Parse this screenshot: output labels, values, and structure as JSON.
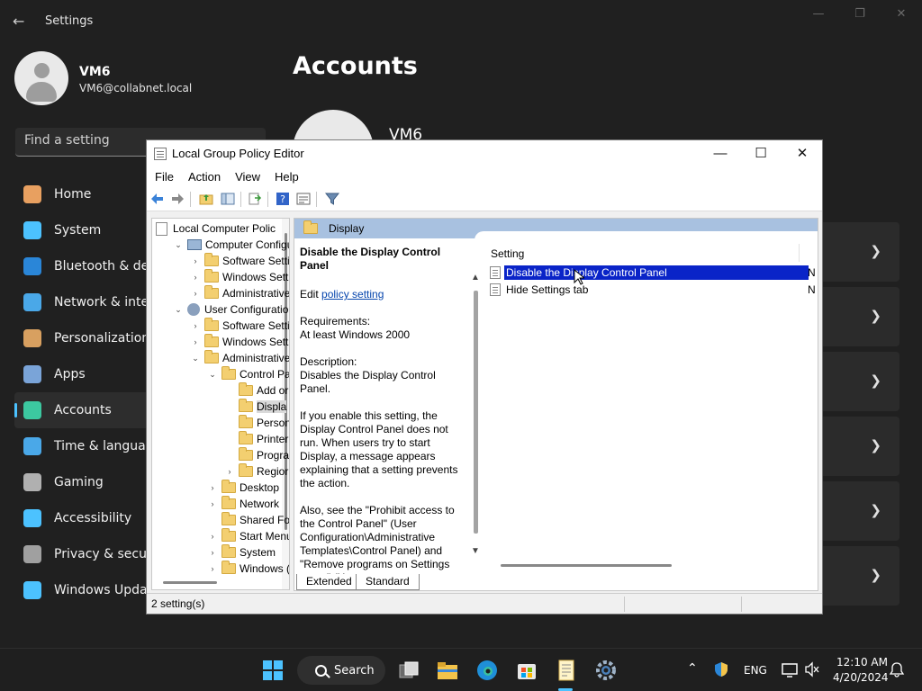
{
  "settings": {
    "app_title": "Settings",
    "profile": {
      "name": "VM6",
      "email": "VM6@collabnet.local"
    },
    "search_placeholder": "Find a setting",
    "page_heading": "Accounts",
    "account_name": "VM6",
    "nav_items": [
      {
        "label": "Home",
        "icon": "home-icon",
        "color": "#e8a060"
      },
      {
        "label": "System",
        "icon": "system-icon",
        "color": "#4cc2ff"
      },
      {
        "label": "Bluetooth & devices",
        "icon": "bluetooth-icon",
        "color": "#2a86d8"
      },
      {
        "label": "Network & internet",
        "icon": "wifi-icon",
        "color": "#4aa8e8"
      },
      {
        "label": "Personalization",
        "icon": "brush-icon",
        "color": "#d8a060"
      },
      {
        "label": "Apps",
        "icon": "apps-icon",
        "color": "#7aa4d8"
      },
      {
        "label": "Accounts",
        "icon": "person-icon",
        "color": "#3cc8a0"
      },
      {
        "label": "Time & language",
        "icon": "clock-globe-icon",
        "color": "#4aa8e8"
      },
      {
        "label": "Gaming",
        "icon": "controller-icon",
        "color": "#b0b0b0"
      },
      {
        "label": "Accessibility",
        "icon": "accessibility-icon",
        "color": "#4cc2ff"
      },
      {
        "label": "Privacy & security",
        "icon": "shield-icon",
        "color": "#a0a0a0"
      },
      {
        "label": "Windows Update",
        "icon": "update-icon",
        "color": "#4cc2ff"
      }
    ],
    "active_nav": "Accounts"
  },
  "gpe": {
    "title": "Local Group Policy Editor",
    "menu": [
      "File",
      "Action",
      "View",
      "Help"
    ],
    "tree": [
      {
        "label": "Local Computer Polic",
        "level": 0,
        "icon": "doc",
        "twisty": ""
      },
      {
        "label": "Computer Configu",
        "level": 1,
        "icon": "pc",
        "twisty": "v"
      },
      {
        "label": "Software Setti",
        "level": 2,
        "icon": "folder",
        "twisty": ">"
      },
      {
        "label": "Windows Sett",
        "level": 2,
        "icon": "folder",
        "twisty": ">"
      },
      {
        "label": "Administrative",
        "level": 2,
        "icon": "folder",
        "twisty": ">"
      },
      {
        "label": "User Configuratio",
        "level": 1,
        "icon": "user",
        "twisty": "v"
      },
      {
        "label": "Software Setti",
        "level": 2,
        "icon": "folder",
        "twisty": ">"
      },
      {
        "label": "Windows Sett",
        "level": 2,
        "icon": "folder",
        "twisty": ">"
      },
      {
        "label": "Administrative",
        "level": 2,
        "icon": "folder",
        "twisty": "v"
      },
      {
        "label": "Control Pa",
        "level": 3,
        "icon": "folder",
        "twisty": "v"
      },
      {
        "label": "Add or",
        "level": 4,
        "icon": "folder",
        "twisty": ""
      },
      {
        "label": "Displa",
        "level": 4,
        "icon": "folder",
        "twisty": "",
        "selected": true
      },
      {
        "label": "Person",
        "level": 4,
        "icon": "folder",
        "twisty": ""
      },
      {
        "label": "Printer",
        "level": 4,
        "icon": "folder",
        "twisty": ""
      },
      {
        "label": "Progra",
        "level": 4,
        "icon": "folder",
        "twisty": ""
      },
      {
        "label": "Regior",
        "level": 4,
        "icon": "folder",
        "twisty": ">"
      },
      {
        "label": "Desktop",
        "level": 3,
        "icon": "folder",
        "twisty": ">"
      },
      {
        "label": "Network",
        "level": 3,
        "icon": "folder",
        "twisty": ">"
      },
      {
        "label": "Shared Fol",
        "level": 3,
        "icon": "folder",
        "twisty": ""
      },
      {
        "label": "Start Menu",
        "level": 3,
        "icon": "folder",
        "twisty": ">"
      },
      {
        "label": "System",
        "level": 3,
        "icon": "folder",
        "twisty": ">"
      },
      {
        "label": "Windows (",
        "level": 3,
        "icon": "folder",
        "twisty": ">"
      }
    ],
    "header_title": "Display",
    "description": {
      "title": "Disable the Display Control Panel",
      "edit_prefix": "Edit ",
      "edit_link": "policy setting",
      "req_label": "Requirements:",
      "req_value": "At least Windows 2000",
      "desc_label": "Description:",
      "desc_value": "Disables the Display Control Panel.",
      "para1": "If you enable this setting, the Display Control Panel does not run. When users try to start Display, a message appears explaining that a setting prevents the action.",
      "para2": "Also, see the \"Prohibit access to the Control Panel\" (User Configuration\\Administrative Templates\\Control Panel) and \"Remove programs on Settings menu\" (User Configuration\\Administrative"
    },
    "column_setting": "Setting",
    "rows": [
      {
        "name": "Disable the Display Control Panel",
        "state": "N",
        "selected": true
      },
      {
        "name": "Hide Settings tab",
        "state": "N",
        "selected": false
      }
    ],
    "tabs": [
      "Extended",
      "Standard"
    ],
    "status": "2 setting(s)"
  },
  "taskbar": {
    "search_label": "Search",
    "lang": "ENG",
    "time": "12:10 AM",
    "date": "4/20/2024"
  }
}
